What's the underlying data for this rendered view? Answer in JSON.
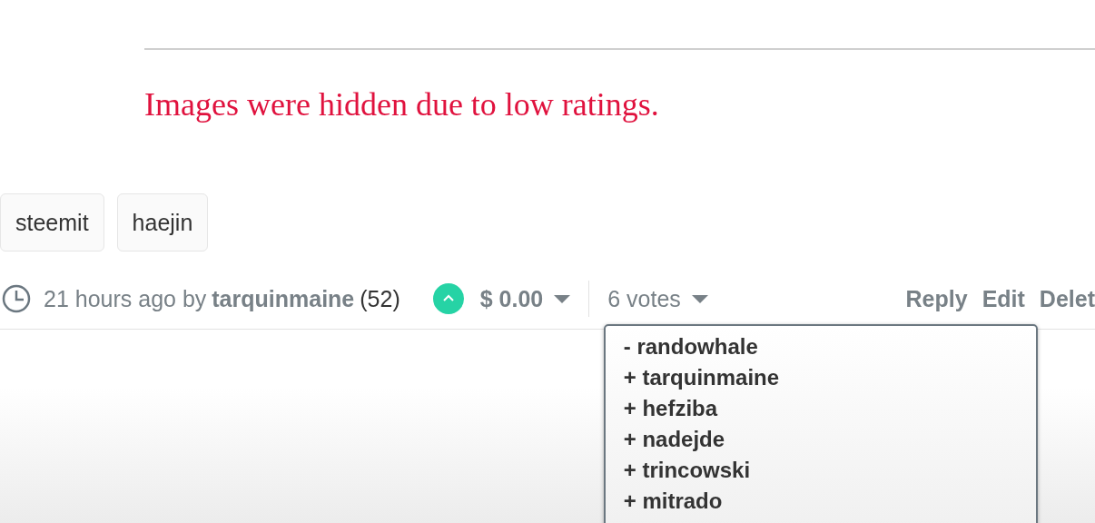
{
  "notice": "Images were hidden due to low ratings.",
  "tags": [
    "steemit",
    "haejin"
  ],
  "footer": {
    "time": "21 hours ago by",
    "author": "tarquinmaine",
    "reputation": "(52)",
    "upvoted": true,
    "payout": "$ 0.00",
    "votes": "6 votes",
    "actions": [
      "Reply",
      "Edit",
      "Delet"
    ]
  },
  "voters": [
    "- randowhale",
    "+ tarquinmaine",
    "+ hefziba",
    "+ nadejde",
    "+ trincowski",
    "+ mitrado"
  ]
}
